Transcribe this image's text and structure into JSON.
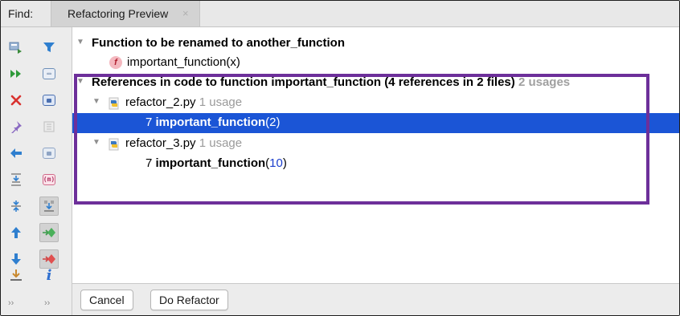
{
  "tabbar": {
    "find_label": "Find:",
    "active_tab_label": "Refactoring Preview",
    "close_glyph": "×"
  },
  "toolbar": {
    "more_left": "››",
    "more_right": "››",
    "info_glyph": "i",
    "m_glyph": "(m)"
  },
  "tree": {
    "rename_header": "Function to be renamed to another_function",
    "function_item": "important_function(x)",
    "references_header": "References in code to function important_function (4 references in 2 files)",
    "references_usages": "2 usages",
    "files": [
      {
        "name": "refactor_2.py",
        "usages": "1 usage",
        "line_number": "7",
        "call_name": "important_function",
        "call_open": "(",
        "call_arg": "2",
        "call_close": ")"
      },
      {
        "name": "refactor_3.py",
        "usages": "1 usage",
        "line_number": "7",
        "call_name": "important_function",
        "call_open": "(",
        "call_arg": "10",
        "call_close": ")"
      }
    ]
  },
  "buttons": {
    "cancel": "Cancel",
    "do_refactor": "Do Refactor"
  },
  "colors": {
    "selection": "#1b55d6",
    "highlight_border": "#6d2f9a",
    "number_blue": "#1a3dcc"
  },
  "icons": [
    "rerun-icon",
    "filter-icon",
    "run-all-icon",
    "merge-icon",
    "close-icon",
    "module-icon",
    "pin-icon",
    "group-icon",
    "back-icon",
    "directory-icon",
    "expand-all-icon",
    "method-icon",
    "collapse-all-icon",
    "autoscroll-icon",
    "up-icon",
    "next-occurrence-icon",
    "down-icon",
    "prev-occurrence-icon",
    "export-icon",
    "info-icon",
    "function-icon",
    "python-file-icon"
  ]
}
